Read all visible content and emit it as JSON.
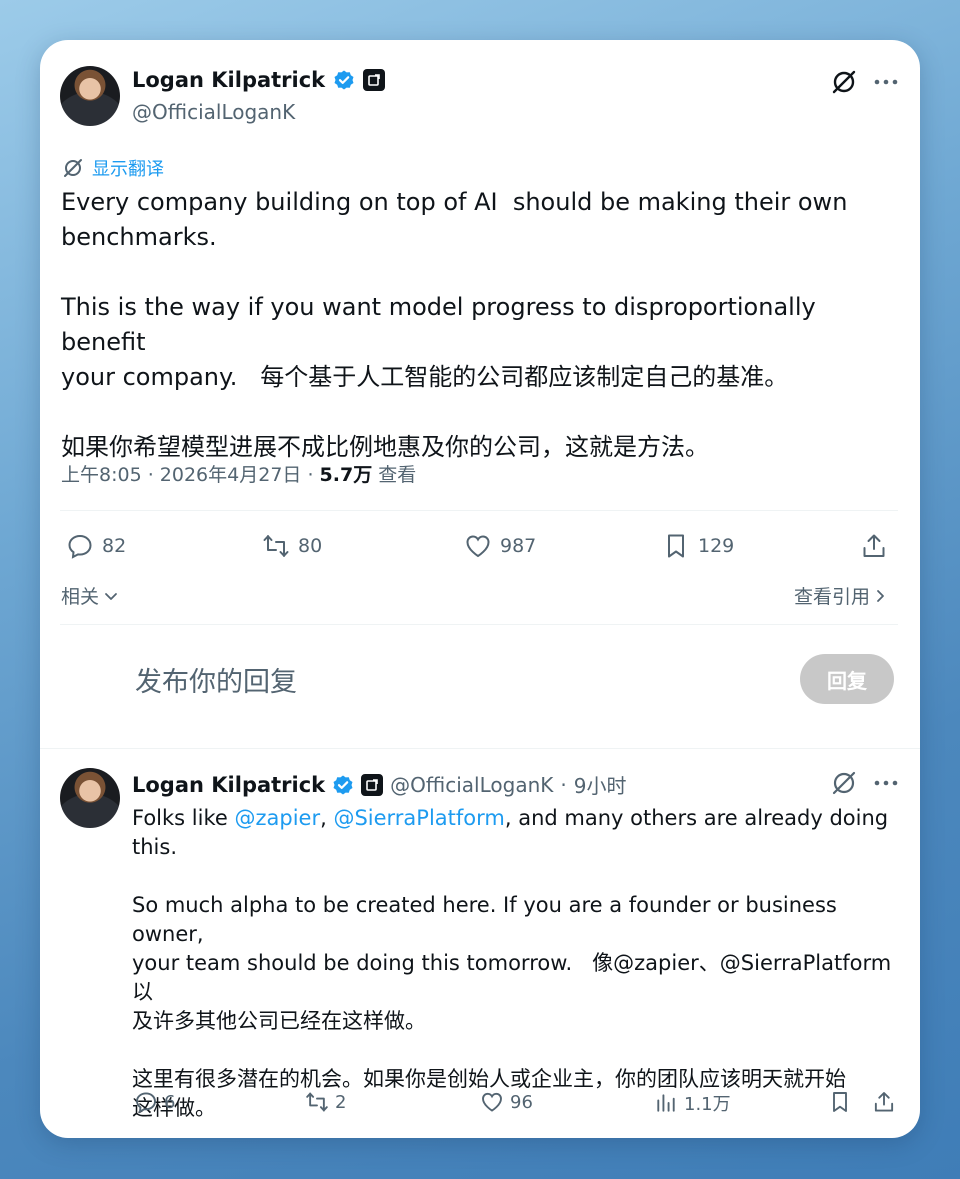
{
  "tweet": {
    "author_name": "Logan Kilpatrick",
    "author_handle": "@OfficialLoganK",
    "translate_label": "显示翻译",
    "text": "Every company building on top of AI  should be making their own\nbenchmarks.\n\nThis is the way if you want model progress to disproportionally benefit\nyour company.   每个基于人工智能的公司都应该制定自己的基准。\n\n如果你希望模型进展不成比例地惠及你的公司，这就是方法。",
    "time": "上午8:05",
    "date": "2026年4月27日",
    "views_count": "5.7万",
    "views_label": "查看",
    "replies": "82",
    "retweets": "80",
    "likes": "987",
    "bookmarks": "129",
    "related_label": "相关",
    "view_quotes_label": "查看引用"
  },
  "compose": {
    "placeholder": "发布你的回复",
    "reply_button": "回复"
  },
  "reply": {
    "author_name": "Logan Kilpatrick",
    "author_handle": "@OfficialLoganK",
    "age": "9小时",
    "text_before": "Folks like ",
    "mention1": "@zapier",
    "comma": ", ",
    "mention2": "@SierraPlatform",
    "text_after": ", and many others are already doing\nthis.\n\nSo much alpha to be created here. If you are a founder or business owner,\nyour team should be doing this tomorrow.   像@zapier、@SierraPlatform以\n及许多其他公司已经在这样做。\n\n这里有很多潜在的机会。如果你是创始人或企业主，你的团队应该明天就开始\n这样做。",
    "replies": "6",
    "retweets": "2",
    "likes": "96",
    "views": "1.1万"
  },
  "colors": {
    "accent": "#1d9bf0",
    "verified": "#1d9bf0",
    "text": "#0f1419",
    "secondary": "#536471"
  }
}
